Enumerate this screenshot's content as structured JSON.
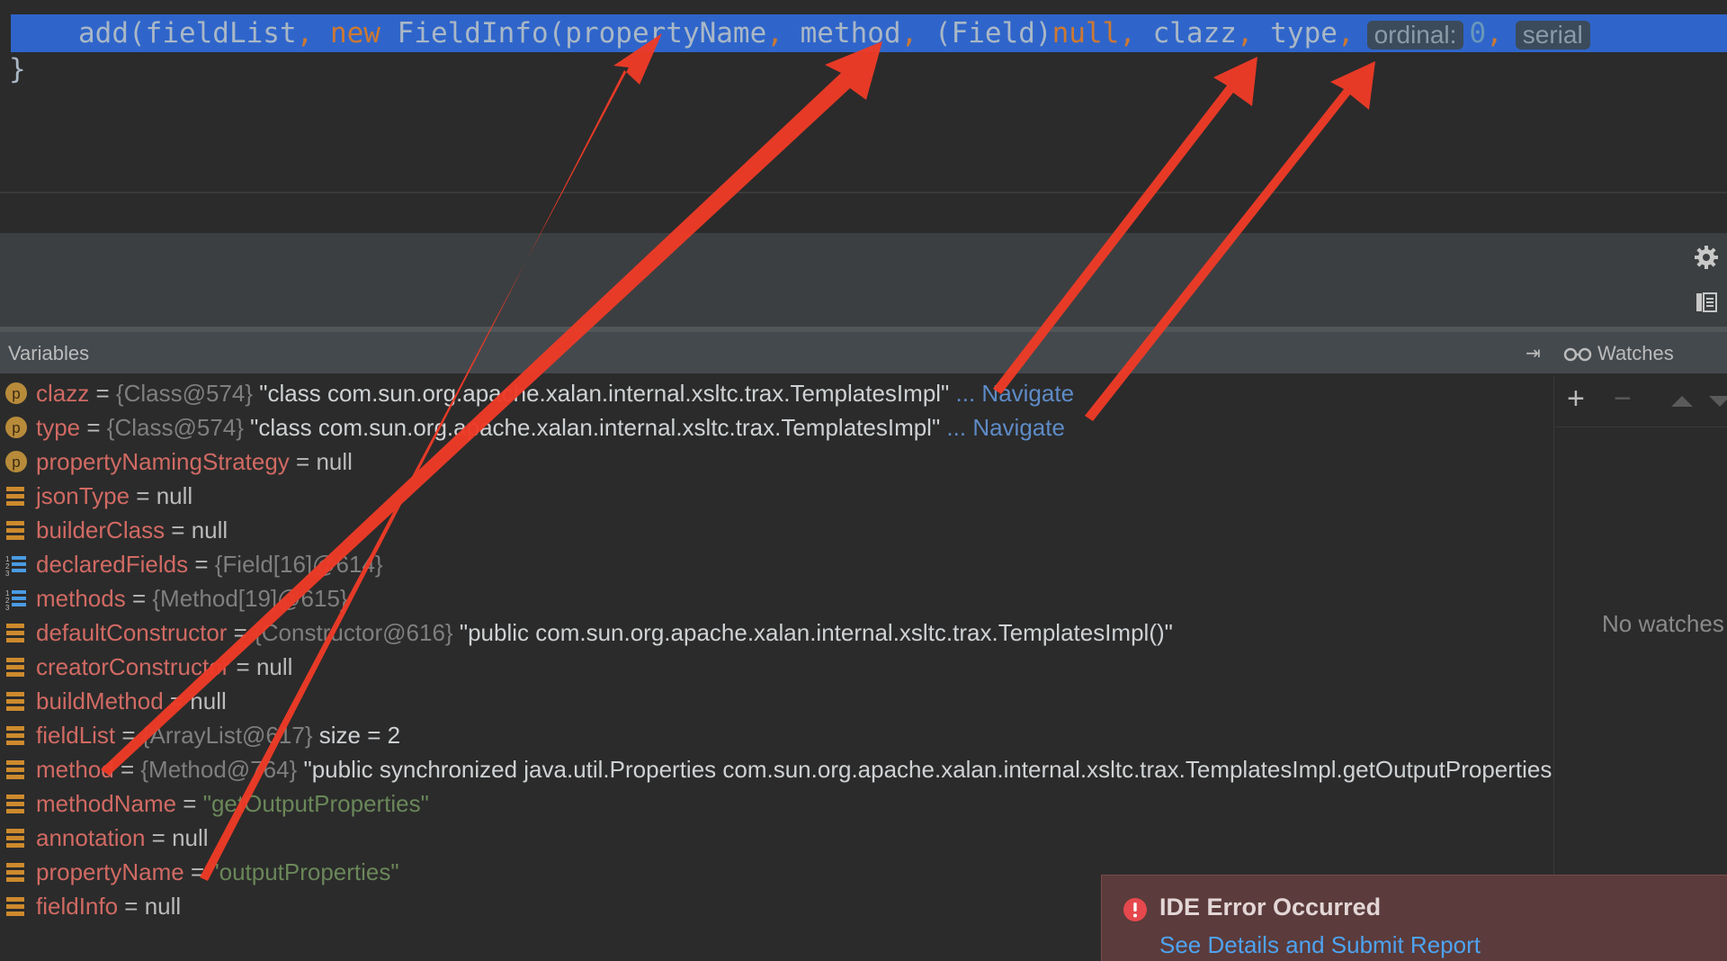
{
  "editor": {
    "code_line_1": {
      "call": "add(",
      "arg1": "fieldList",
      "comma1": ",",
      "kw_new": "new",
      "ctor": "FieldInfo(",
      "arg_property": "propertyName",
      "comma2": ",",
      "arg_method": "method",
      "comma3": ",",
      "cast": "(Field)",
      "null_literal": "null",
      "comma4": ",",
      "arg_clazz": "clazz",
      "comma5": ",",
      "arg_type": "type",
      "comma6": ",",
      "hint_ordinal": "ordinal:",
      "ordinal_value": "0",
      "comma7": ",",
      "hint_serial": "serial"
    },
    "code_line_2": "}"
  },
  "panels": {
    "variables_title": "Variables",
    "watches_title": "Watches",
    "no_watches": "No watches",
    "add_watch": "+",
    "remove_watch": "−"
  },
  "variables": [
    {
      "icon": "p",
      "name": "clazz",
      "eq": " = ",
      "ref": "{Class@574}",
      "value": " \"class com.sun.org.apache.xalan.internal.xsltc.trax.TemplatesImpl\"",
      "nav": " ... Navigate"
    },
    {
      "icon": "p",
      "name": "type",
      "eq": " = ",
      "ref": "{Class@574}",
      "value": " \"class com.sun.org.apache.xalan.internal.xsltc.trax.TemplatesImpl\"",
      "nav": " ... Navigate"
    },
    {
      "icon": "p",
      "name": "propertyNamingStrategy",
      "eq": " = ",
      "ref": "",
      "value": "null",
      "nav": ""
    },
    {
      "icon": "field",
      "name": "jsonType",
      "eq": " = ",
      "ref": "",
      "value": "null",
      "nav": ""
    },
    {
      "icon": "field",
      "name": "builderClass",
      "eq": " = ",
      "ref": "",
      "value": "null",
      "nav": ""
    },
    {
      "icon": "array",
      "name": "declaredFields",
      "eq": " = ",
      "ref": "{Field[16]@614}",
      "value": "",
      "nav": ""
    },
    {
      "icon": "array",
      "name": "methods",
      "eq": " = ",
      "ref": "{Method[19]@615}",
      "value": "",
      "nav": ""
    },
    {
      "icon": "field",
      "name": "defaultConstructor",
      "eq": " = ",
      "ref": "{Constructor@616}",
      "value": " \"public com.sun.org.apache.xalan.internal.xsltc.trax.TemplatesImpl()\"",
      "nav": ""
    },
    {
      "icon": "field",
      "name": "creatorConstructor",
      "eq": " = ",
      "ref": "",
      "value": "null",
      "nav": ""
    },
    {
      "icon": "field",
      "name": "buildMethod",
      "eq": " = ",
      "ref": "",
      "value": "null",
      "nav": ""
    },
    {
      "icon": "field",
      "name": "fieldList",
      "eq": " = ",
      "ref": "{ArrayList@617}",
      "value": "  size = 2",
      "nav": ""
    },
    {
      "icon": "field",
      "name": "method",
      "eq": " = ",
      "ref": "{Method@764}",
      "value": " \"public synchronized java.util.Properties com.sun.org.apache.xalan.internal.xsltc.trax.TemplatesImpl.getOutputProperties()\"",
      "nav": ""
    },
    {
      "icon": "field",
      "name": "methodName",
      "eq": " = ",
      "ref": "",
      "value": "\"getOutputProperties\"",
      "nav": "",
      "green": true
    },
    {
      "icon": "field",
      "name": "annotation",
      "eq": " = ",
      "ref": "",
      "value": "null",
      "nav": ""
    },
    {
      "icon": "field",
      "name": "propertyName",
      "eq": " = ",
      "ref": "",
      "value": "\"outputProperties\"",
      "nav": "",
      "green": true
    },
    {
      "icon": "field",
      "name": "fieldInfo",
      "eq": " = ",
      "ref": "",
      "value": "null",
      "nav": ""
    }
  ],
  "error_toast": {
    "title": "IDE Error Occurred",
    "link": "See Details and Submit Report"
  },
  "colors": {
    "editor_bg": "#2b2b2b",
    "selection": "#2f65ca",
    "panel_header": "#44494e",
    "variable_name": "#d16a63",
    "string_green": "#6a8759",
    "link_blue": "#5e8bc7",
    "annotation_red": "#ee3b27",
    "error_bg": "#5b3b3b"
  }
}
